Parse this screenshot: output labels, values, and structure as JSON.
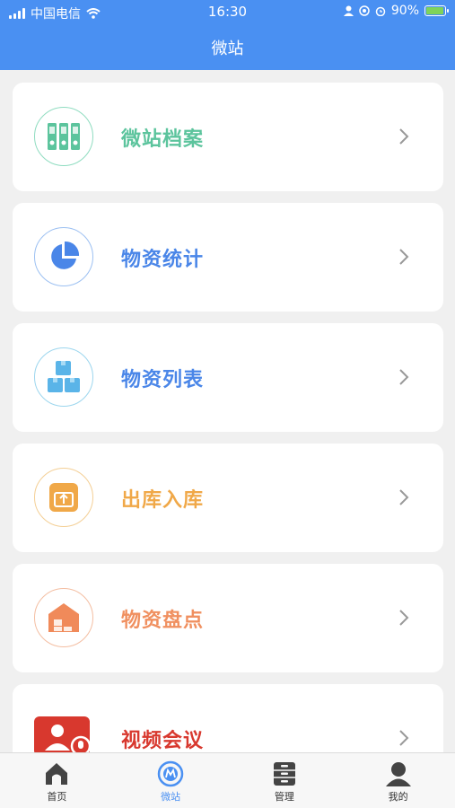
{
  "status_bar": {
    "carrier": "中国电信",
    "time": "16:30",
    "battery": "90%"
  },
  "header": {
    "title": "微站"
  },
  "menu": [
    {
      "label": "微站档案",
      "icon": "binders-icon",
      "color": "#5cc49d"
    },
    {
      "label": "物资统计",
      "icon": "pie-chart-icon",
      "color": "#4a86e8"
    },
    {
      "label": "物资列表",
      "icon": "boxes-icon",
      "color": "#4a86e8"
    },
    {
      "label": "出库入库",
      "icon": "inbox-upload-icon",
      "color": "#f0a848"
    },
    {
      "label": "物资盘点",
      "icon": "warehouse-icon",
      "color": "#f09060"
    },
    {
      "label": "视频会议",
      "icon": "video-meeting-icon",
      "color": "#d8382e"
    }
  ],
  "tabbar": [
    {
      "label": "首页",
      "icon": "home-icon",
      "active": false
    },
    {
      "label": "微站",
      "icon": "station-icon",
      "active": true
    },
    {
      "label": "管理",
      "icon": "cabinet-icon",
      "active": false
    },
    {
      "label": "我的",
      "icon": "user-icon",
      "active": false
    }
  ],
  "colors": {
    "header": "#4a90f2",
    "background": "#f0f0f0"
  }
}
